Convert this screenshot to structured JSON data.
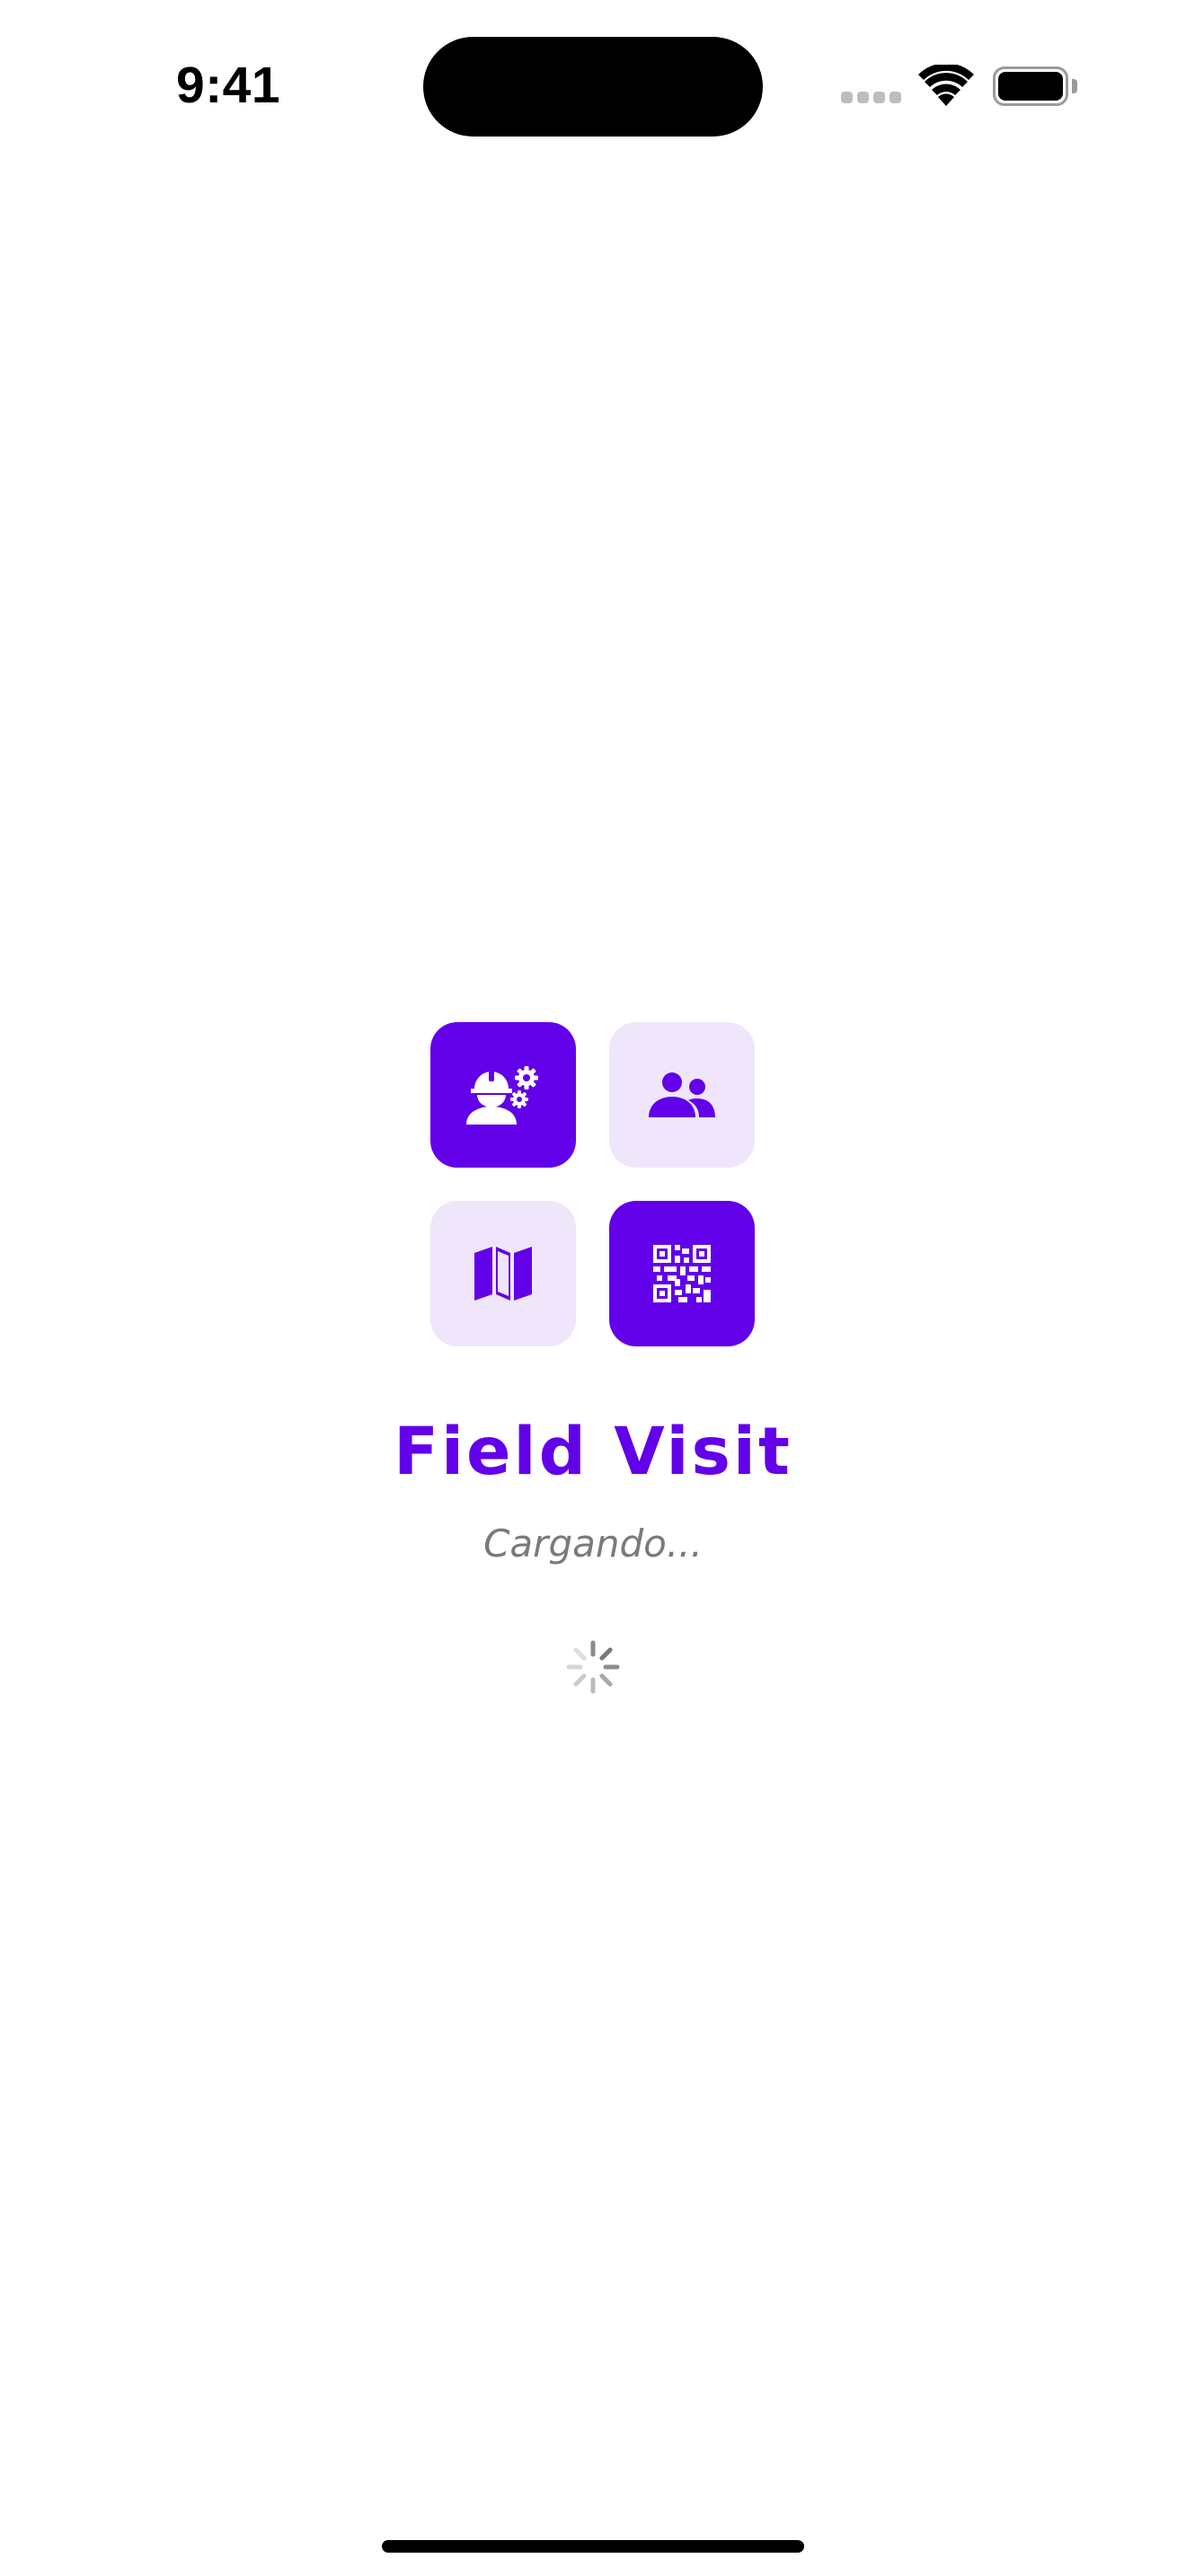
{
  "status_bar": {
    "time": "9:41"
  },
  "splash": {
    "title": "Field Visit",
    "loading_text": "Cargando...",
    "tiles": [
      {
        "icon": "engineer-gears-icon",
        "style": "solid"
      },
      {
        "icon": "people-icon",
        "style": "soft"
      },
      {
        "icon": "map-icon",
        "style": "soft"
      },
      {
        "icon": "qr-code-icon",
        "style": "solid"
      }
    ],
    "spinner": "loading-spinner-icon"
  },
  "colors": {
    "accent": "#6200ea",
    "accent_soft": "#f0e6fc",
    "muted_text": "#7a7a7a",
    "background": "#ffffff"
  }
}
